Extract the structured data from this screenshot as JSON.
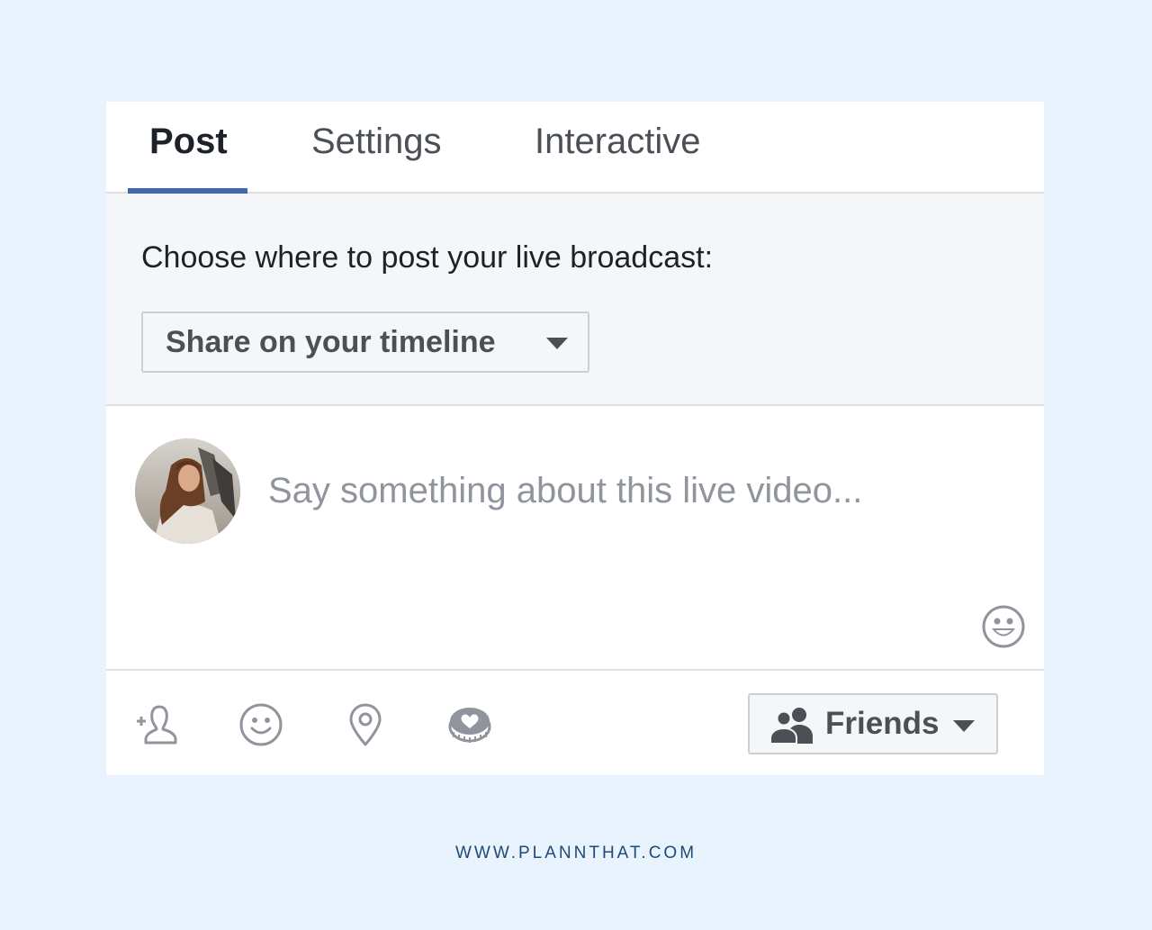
{
  "tabs": [
    {
      "label": "Post",
      "active": true
    },
    {
      "label": "Settings",
      "active": false
    },
    {
      "label": "Interactive",
      "active": false
    }
  ],
  "post_section": {
    "label": "Choose where to post your live broadcast:",
    "destination": {
      "selected": "Share on your timeline",
      "icon": "chevron-down-icon"
    }
  },
  "composer": {
    "avatar": "user-avatar",
    "placeholder": "Say something about this live video...",
    "value": "",
    "emoji_icon": "emoji-icon"
  },
  "toolbar": {
    "icons": [
      "tag-people-icon",
      "feeling-icon",
      "location-icon",
      "donate-icon"
    ],
    "audience": {
      "label": "Friends",
      "icon": "friends-icon"
    }
  },
  "footer": {
    "text": "WWW.PLANNTHAT.COM"
  },
  "colors": {
    "accent": "#4267b2",
    "background": "#e8f3fe",
    "panel": "#f5f6f7",
    "text_dark": "#1d2129",
    "text_gray": "#4b4f56",
    "placeholder": "#90949c",
    "footer_text": "#1e4a77"
  }
}
